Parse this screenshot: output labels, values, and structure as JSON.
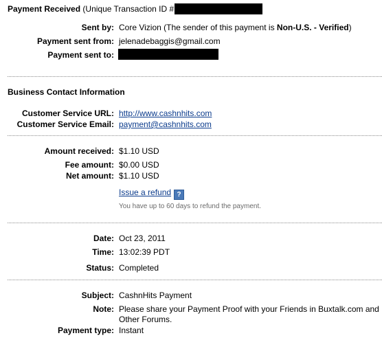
{
  "header": {
    "title": "Payment Received",
    "transaction_prefix": "(Unique Transaction ID #"
  },
  "sender": {
    "sent_by_label": "Sent by:",
    "sent_by_name": "Core Vizion",
    "sent_by_note_prefix": "(The sender of this payment is ",
    "sent_by_status": "Non-U.S. - Verified",
    "sent_by_note_suffix": ")",
    "sent_from_label": "Payment sent from:",
    "sent_from_value": "jelenadebaggis@gmail.com",
    "sent_to_label": "Payment sent to:"
  },
  "business": {
    "heading": "Business Contact Information",
    "url_label": "Customer Service URL:",
    "url_value": "http://www.cashnhits.com",
    "email_label": "Customer Service Email:",
    "email_value": "payment@cashnhits.com"
  },
  "amounts": {
    "received_label": "Amount received:",
    "received_value": "$1.10 USD",
    "fee_label": "Fee amount:",
    "fee_value": "$0.00 USD",
    "net_label": "Net amount:",
    "net_value": "$1.10 USD",
    "refund_link": "Issue a refund",
    "help_glyph": "?",
    "refund_note": "You have up to 60 days to refund the payment."
  },
  "details": {
    "date_label": "Date:",
    "date_value": "Oct 23, 2011",
    "time_label": "Time:",
    "time_value": "13:02:39 PDT",
    "status_label": "Status:",
    "status_value": "Completed"
  },
  "message": {
    "subject_label": "Subject:",
    "subject_value": "CashnHits Payment",
    "note_label": "Note:",
    "note_line1": "Please share your Payment Proof with your Friends in Buxtalk.com and",
    "note_line2": "Other Forums.",
    "type_label": "Payment type:",
    "type_value": "Instant"
  },
  "colors": {
    "link": "#0b3b8c",
    "help_icon": "#4a7ab8",
    "note_grey": "#6a6a6a",
    "redaction": "#000000"
  },
  "icons": {
    "help": "question-mark-icon"
  }
}
